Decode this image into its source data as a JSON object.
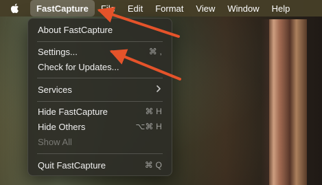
{
  "menubar": {
    "apple_icon": "apple-logo-icon",
    "items": [
      "FastCapture",
      "File",
      "Edit",
      "Format",
      "View",
      "Window",
      "Help"
    ]
  },
  "app_menu": {
    "about": "About FastCapture",
    "settings": {
      "label": "Settings...",
      "shortcut": "⌘ ,"
    },
    "check_updates": "Check for Updates...",
    "services": {
      "label": "Services",
      "submenu_icon": "chevron-right-icon"
    },
    "hide": {
      "label": "Hide FastCapture",
      "shortcut": "⌘ H"
    },
    "hide_others": {
      "label": "Hide Others",
      "shortcut": "⌥⌘ H"
    },
    "show_all": "Show All",
    "quit": {
      "label": "Quit FastCapture",
      "shortcut": "⌘ Q"
    }
  },
  "annotation": {
    "arrow_color": "#e5532a",
    "arrow_icons": [
      "arrow-to-app-menu-icon",
      "arrow-to-settings-icon"
    ]
  }
}
